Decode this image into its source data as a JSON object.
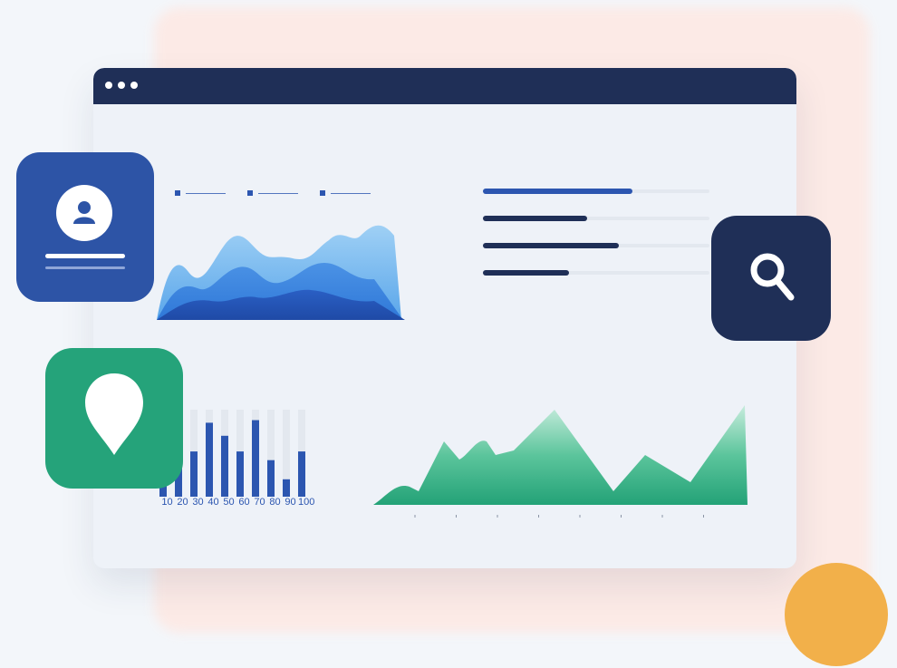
{
  "colors": {
    "navy": "#1f2f57",
    "blue": "#2c56b0",
    "green": "#25a37a",
    "orange": "#f2b04a",
    "peach": "#fde9e4"
  },
  "icons": [
    "user-icon",
    "search-icon",
    "location-pin-icon"
  ],
  "area_chart": {
    "type": "area",
    "series_count": 3
  },
  "progress_bars": [
    {
      "value": 0.66,
      "color": "#2c56b0"
    },
    {
      "value": 0.46,
      "color": "#1f2f57"
    },
    {
      "value": 0.6,
      "color": "#1f2f57"
    },
    {
      "value": 0.38,
      "color": "#1f2f57"
    }
  ],
  "bar_chart": {
    "type": "bar",
    "categories": [
      "10",
      "20",
      "30",
      "40",
      "50",
      "60",
      "70",
      "80",
      "90",
      "100"
    ],
    "values": [
      82,
      90,
      52,
      85,
      70,
      52,
      88,
      42,
      20,
      52
    ]
  },
  "green_chart": {
    "type": "area",
    "tick_count": 8
  }
}
